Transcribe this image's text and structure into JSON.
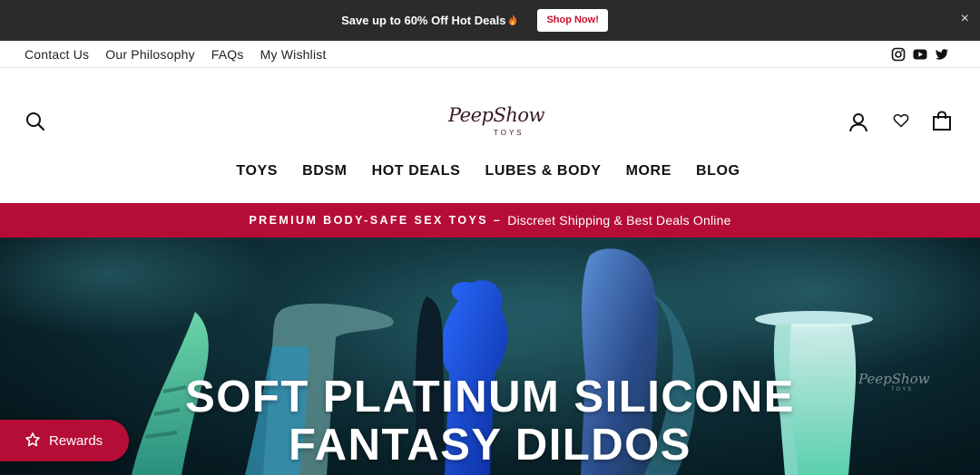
{
  "announcement": {
    "text": "Save up to 60% Off Hot Deals",
    "flame_icon": "flame-icon",
    "button": "Shop Now!",
    "close": "×"
  },
  "utility_nav": {
    "links": [
      "Contact Us",
      "Our Philosophy",
      "FAQs",
      "My Wishlist"
    ],
    "social": [
      "instagram-icon",
      "youtube-icon",
      "twitter-icon"
    ]
  },
  "header": {
    "logo_main": "PeepShow",
    "logo_sub": "TOYS",
    "icons": [
      "search-icon",
      "account-icon",
      "heart-icon",
      "cart-icon"
    ],
    "nav": [
      "TOYS",
      "BDSM",
      "HOT DEALS",
      "LUBES & BODY",
      "MORE",
      "BLOG"
    ]
  },
  "promo": {
    "strong": "PREMIUM BODY-SAFE SEX TOYS –",
    "rest": "Discreet Shipping & Best Deals Online"
  },
  "hero": {
    "title_line1": "SOFT PLATINUM SILICONE",
    "title_line2": "FANTASY DILDOS",
    "watermark_main": "PeepShow",
    "watermark_sub": "TOYS"
  },
  "rewards": {
    "label": "Rewards"
  },
  "colors": {
    "announcement_bg": "#2b2b2b",
    "brand_red": "#b50d36",
    "shop_button_text": "#c8102e"
  }
}
